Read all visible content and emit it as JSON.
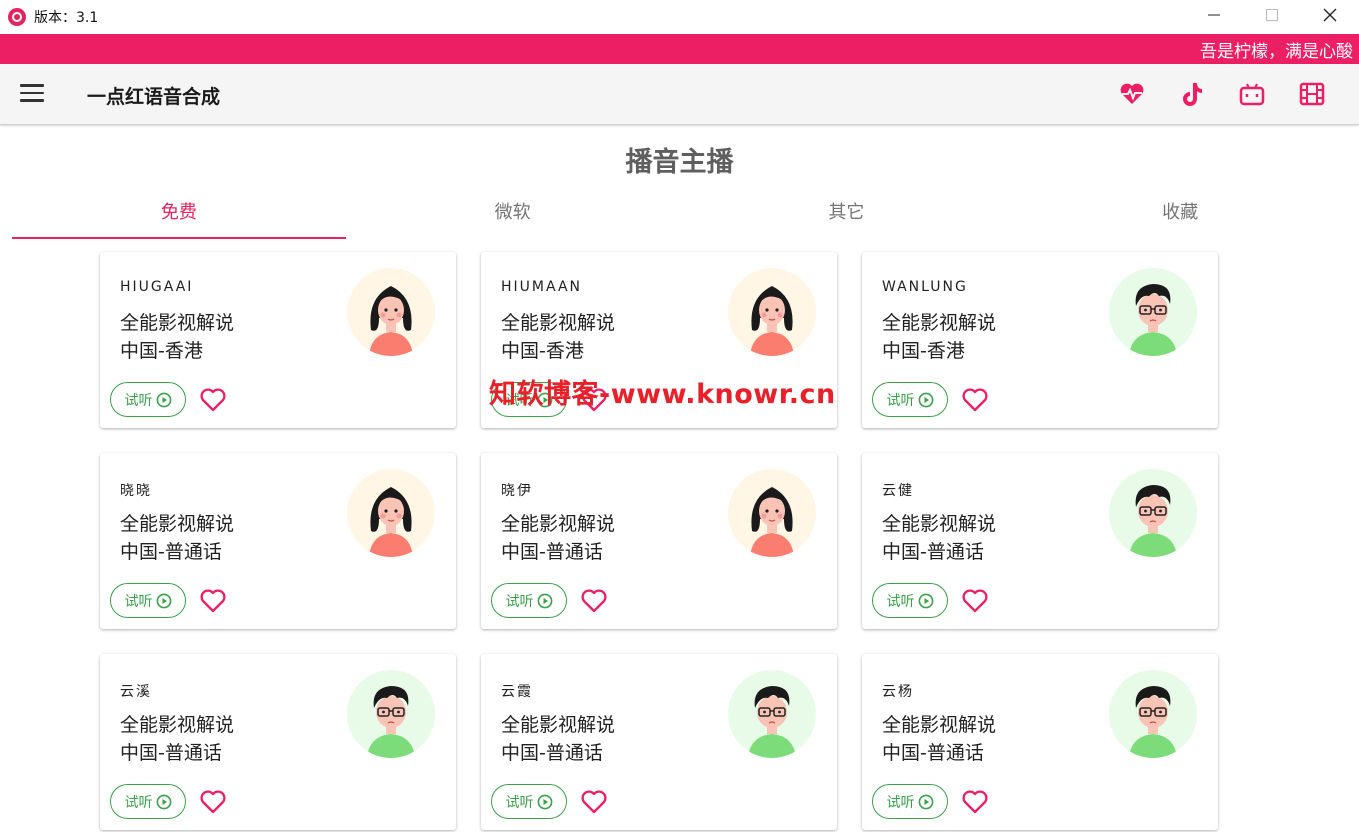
{
  "window": {
    "version_label": "版本：3.1"
  },
  "banner": {
    "text": "吾是柠檬，满是心酸"
  },
  "appbar": {
    "title": "一点红语音合成"
  },
  "page": {
    "section_title": "播音主播"
  },
  "tabs": [
    {
      "label": "免费",
      "active": true
    },
    {
      "label": "微软",
      "active": false
    },
    {
      "label": "其它",
      "active": false
    },
    {
      "label": "收藏",
      "active": false
    }
  ],
  "cards": [
    {
      "code": "HIUGAAI",
      "style": "全能影视解说",
      "region": "中国-香港",
      "avatar": "female-avatar",
      "try_label": "试听"
    },
    {
      "code": "HIUMAAN",
      "style": "全能影视解说",
      "region": "中国-香港",
      "avatar": "female-avatar",
      "try_label": "试听"
    },
    {
      "code": "WANLUNG",
      "style": "全能影视解说",
      "region": "中国-香港",
      "avatar": "male-avatar",
      "try_label": "试听"
    },
    {
      "code": "晓晓",
      "style": "全能影视解说",
      "region": "中国-普通话",
      "avatar": "female-avatar",
      "try_label": "试听"
    },
    {
      "code": "晓伊",
      "style": "全能影视解说",
      "region": "中国-普通话",
      "avatar": "female-avatar",
      "try_label": "试听"
    },
    {
      "code": "云健",
      "style": "全能影视解说",
      "region": "中国-普通话",
      "avatar": "male-avatar",
      "try_label": "试听"
    },
    {
      "code": "云溪",
      "style": "全能影视解说",
      "region": "中国-普通话",
      "avatar": "male-avatar",
      "try_label": "试听"
    },
    {
      "code": "云霞",
      "style": "全能影视解说",
      "region": "中国-普通话",
      "avatar": "male-avatar",
      "try_label": "试听"
    },
    {
      "code": "云杨",
      "style": "全能影视解说",
      "region": "中国-普通话",
      "avatar": "male-avatar",
      "try_label": "试听"
    }
  ],
  "watermark": {
    "text": "知软博客-www.knowr.cn"
  },
  "colors": {
    "accent": "#ec1f64",
    "listen_green": "#3aa04a",
    "female_bg": "#fff6e6",
    "male_bg": "#e8fbe8"
  }
}
